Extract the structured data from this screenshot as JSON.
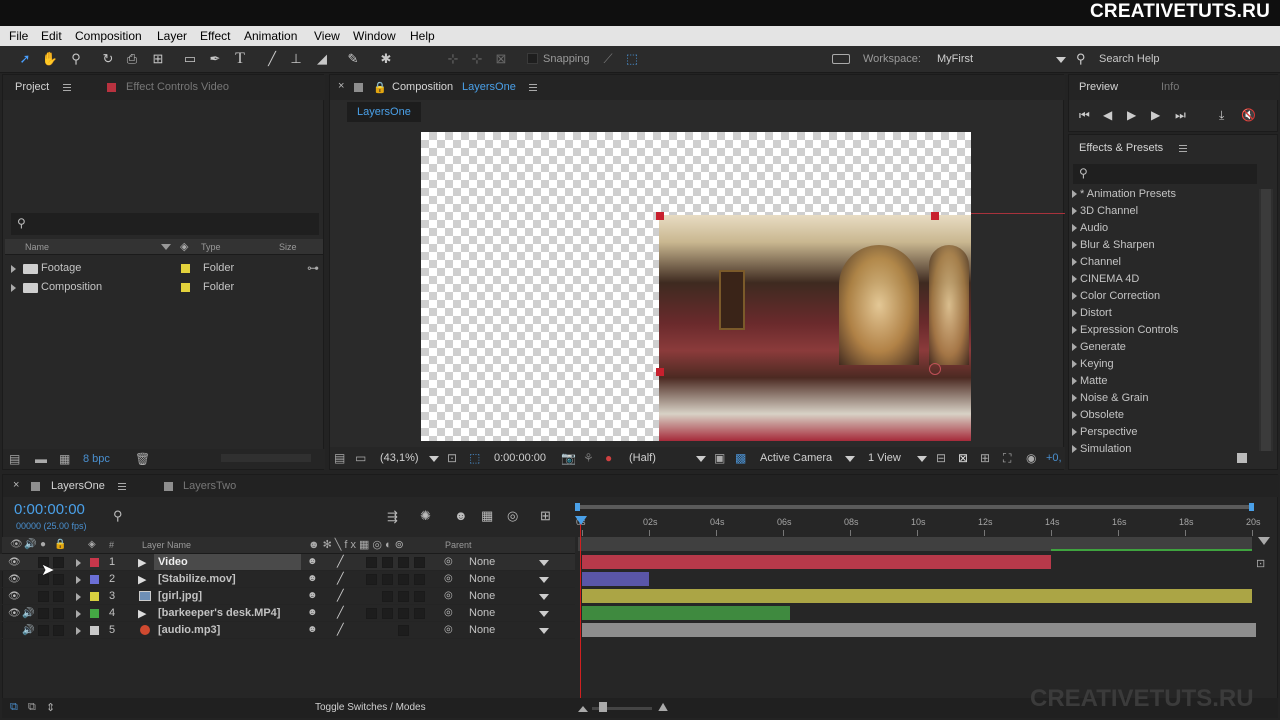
{
  "watermark": "CREATIVETUTS.RU",
  "menu": [
    "File",
    "Edit",
    "Composition",
    "Layer",
    "Effect",
    "Animation",
    "View",
    "Window",
    "Help"
  ],
  "toolbar": {
    "snapping": "Snapping",
    "workspace_label": "Workspace:",
    "workspace_value": "MyFirst",
    "search_help": "Search Help"
  },
  "project_panel": {
    "tab_project": "Project",
    "tab_effect_controls": "Effect Controls Video",
    "col_name": "Name",
    "col_type": "Type",
    "col_size": "Size",
    "items": [
      {
        "name": "Footage",
        "type": "Folder"
      },
      {
        "name": "Composition",
        "type": "Folder"
      }
    ],
    "bpc": "8 bpc"
  },
  "composition_panel": {
    "tab_prefix": "Composition",
    "tab_comp_name": "LayersOne",
    "sub_tab": "LayersOne",
    "zoom": "(43,1%)",
    "timecode": "0:00:00:00",
    "resolution": "(Half)",
    "camera": "Active Camera",
    "view": "1 View",
    "exposure": "+0,"
  },
  "preview_panel": {
    "tab_preview": "Preview",
    "tab_info": "Info"
  },
  "effects_panel": {
    "title": "Effects & Presets",
    "items": [
      "* Animation Presets",
      "3D Channel",
      "Audio",
      "Blur & Sharpen",
      "Channel",
      "CINEMA 4D",
      "Color Correction",
      "Distort",
      "Expression Controls",
      "Generate",
      "Keying",
      "Matte",
      "Noise & Grain",
      "Obsolete",
      "Perspective",
      "Simulation"
    ]
  },
  "timeline": {
    "tab_active": "LayersOne",
    "tab_inactive": "LayersTwo",
    "timecode": "0:00:00:00",
    "fps": "00000 (25.00 fps)",
    "col_layer_name": "Layer Name",
    "col_parent": "Parent",
    "col_hash": "#",
    "ruler": [
      "0s",
      "02s",
      "04s",
      "06s",
      "08s",
      "10s",
      "12s",
      "14s",
      "16s",
      "18s",
      "20s"
    ],
    "layers": [
      {
        "num": "1",
        "name": "Video",
        "color": "#c8374b",
        "parent": "None",
        "icon": "composition-icon",
        "bar_start_s": 0,
        "bar_end_s": 14,
        "bar_color": "#b8394a"
      },
      {
        "num": "2",
        "name": "[Stabilize.mov]",
        "color": "#6b6fd6",
        "parent": "None",
        "icon": "composition-icon",
        "bar_start_s": 0,
        "bar_end_s": 2,
        "bar_color": "#5a56a8"
      },
      {
        "num": "3",
        "name": "[girl.jpg]",
        "color": "#d8d040",
        "parent": "None",
        "icon": "image-icon",
        "bar_start_s": 0,
        "bar_end_s": 20,
        "bar_color": "#aba545"
      },
      {
        "num": "4",
        "name": "[barkeeper's desk.MP4]",
        "color": "#44a844",
        "parent": "None",
        "icon": "composition-icon",
        "bar_start_s": 0,
        "bar_end_s": 6.2,
        "bar_color": "#3f8a3f"
      },
      {
        "num": "5",
        "name": "[audio.mp3]",
        "color": "#c8c8c8",
        "parent": "None",
        "icon": "audio-icon",
        "bar_start_s": 0,
        "bar_end_s": 20.2,
        "bar_color": "#8d8d8d"
      }
    ],
    "toggle_label": "Toggle Switches / Modes"
  }
}
